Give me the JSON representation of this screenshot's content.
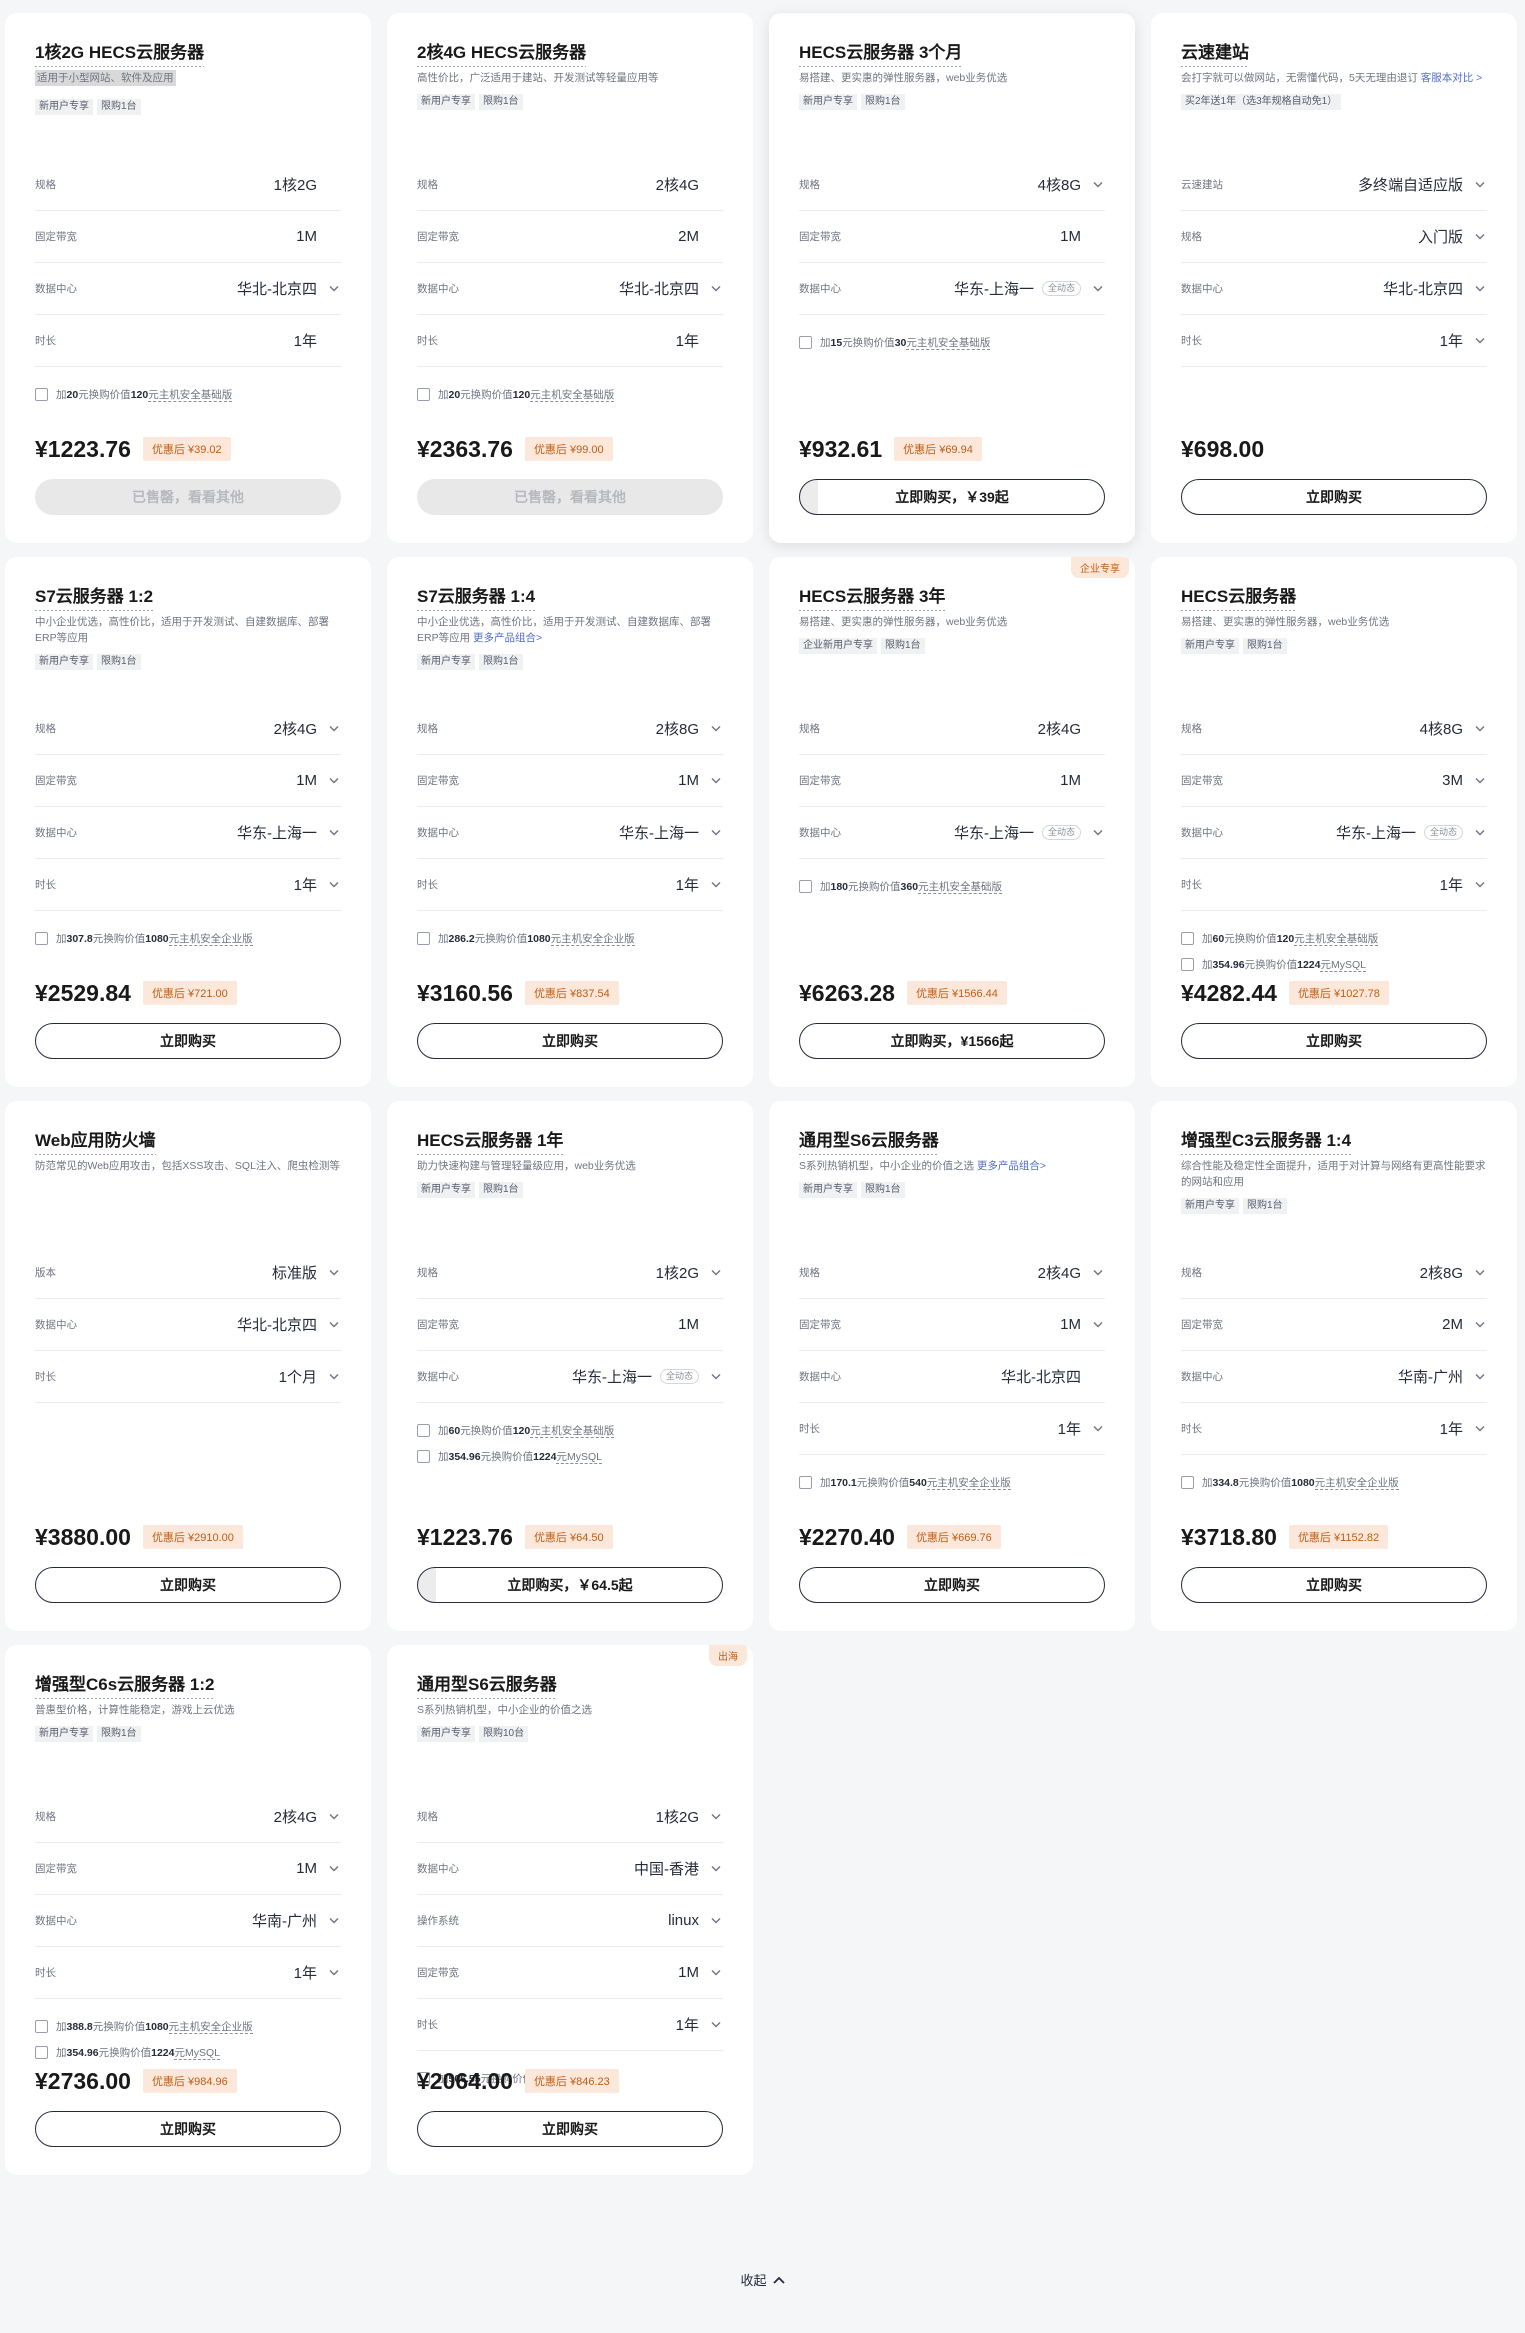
{
  "colors": {
    "accent": "#c15d14",
    "accent_bg": "#fbe8da",
    "text": "#252b3a",
    "link": "#526ecc"
  },
  "cards": [
    {
      "title": "1核2G HECS云服务器",
      "desc": "适用于小型网站、软件及应用",
      "desc_highlight": true,
      "tags": [
        "新用户专享",
        "限购1台"
      ],
      "rows": [
        {
          "label": "规格",
          "value": "1核2G",
          "chev": false
        },
        {
          "label": "固定带宽",
          "value": "1M",
          "chev": false
        },
        {
          "label": "数据中心",
          "value": "华北-北京四",
          "chev": true
        },
        {
          "label": "时长",
          "value": "1年",
          "chev": false
        }
      ],
      "addons": [
        [
          "加",
          "20",
          "元换购价值",
          "120",
          "元主机安全基础版"
        ]
      ],
      "price": "¥1223.76",
      "discount": "优惠后 ¥39.02",
      "button": "已售罄，看看其他",
      "button_state": "disabled"
    },
    {
      "title": "2核4G HECS云服务器",
      "desc": "高性价比，广泛适用于建站、开发测试等轻量应用等",
      "tags": [
        "新用户专享",
        "限购1台"
      ],
      "rows": [
        {
          "label": "规格",
          "value": "2核4G",
          "chev": false
        },
        {
          "label": "固定带宽",
          "value": "2M",
          "chev": false
        },
        {
          "label": "数据中心",
          "value": "华北-北京四",
          "chev": true
        },
        {
          "label": "时长",
          "value": "1年",
          "chev": false
        }
      ],
      "addons": [
        [
          "加",
          "20",
          "元换购价值",
          "120",
          "元主机安全基础版"
        ]
      ],
      "price": "¥2363.76",
      "discount": "优惠后 ¥99.00",
      "button": "已售罄，看看其他",
      "button_state": "disabled"
    },
    {
      "title": "HECS云服务器 3个月",
      "desc": "易搭建、更实惠的弹性服务器，web业务优选",
      "tags": [
        "新用户专享",
        "限购1台"
      ],
      "active": true,
      "rows": [
        {
          "label": "规格",
          "value": "4核8G",
          "chev": true
        },
        {
          "label": "固定带宽",
          "value": "1M",
          "chev": false
        },
        {
          "label": "数据中心",
          "value": "华东-上海一",
          "chev": true,
          "badge": "全动态"
        }
      ],
      "addons": [
        [
          "加",
          "15",
          "元换购价值",
          "30",
          "元主机安全基础版"
        ]
      ],
      "price": "¥932.61",
      "discount": "优惠后 ¥69.94",
      "button": "立即购买，￥39起",
      "button_state": "progress"
    },
    {
      "title": "云速建站",
      "desc": "会打字就可以做网站，无需懂代码，5天无理由退订 ",
      "desc_link": "客服本对比 >",
      "tags": [
        "买2年送1年（选3年规格自动免1）"
      ],
      "rows": [
        {
          "label": "云速建站",
          "value": "多终端自适应版",
          "chev": true
        },
        {
          "label": "规格",
          "value": "入门版",
          "chev": true
        },
        {
          "label": "数据中心",
          "value": "华北-北京四",
          "chev": true
        },
        {
          "label": "时长",
          "value": "1年",
          "chev": true
        }
      ],
      "addons": [],
      "price": "¥698.00",
      "discount": "",
      "button": "立即购买",
      "button_state": "normal"
    },
    {
      "title": "S7云服务器 1:2",
      "desc": "中小企业优选，高性价比，适用于开发测试、自建数据库、部署ERP等应用",
      "tags": [
        "新用户专享",
        "限购1台"
      ],
      "rows": [
        {
          "label": "规格",
          "value": "2核4G",
          "chev": true
        },
        {
          "label": "固定带宽",
          "value": "1M",
          "chev": true
        },
        {
          "label": "数据中心",
          "value": "华东-上海一",
          "chev": true
        },
        {
          "label": "时长",
          "value": "1年",
          "chev": true
        }
      ],
      "addons": [
        [
          "加",
          "307.8",
          "元换购价值",
          "1080",
          "元主机安全企业版"
        ]
      ],
      "price": "¥2529.84",
      "discount": "优惠后 ¥721.00",
      "button": "立即购买",
      "button_state": "normal"
    },
    {
      "title": "S7云服务器 1:4",
      "desc": "中小企业优选，高性价比，适用于开发测试、自建数据库、部署ERP等应用 ",
      "desc_link": "更多产品组合>",
      "tags": [
        "新用户专享",
        "限购1台"
      ],
      "rows": [
        {
          "label": "规格",
          "value": "2核8G",
          "chev": true
        },
        {
          "label": "固定带宽",
          "value": "1M",
          "chev": true
        },
        {
          "label": "数据中心",
          "value": "华东-上海一",
          "chev": true
        },
        {
          "label": "时长",
          "value": "1年",
          "chev": true
        }
      ],
      "addons": [
        [
          "加",
          "286.2",
          "元换购价值",
          "1080",
          "元主机安全企业版"
        ]
      ],
      "price": "¥3160.56",
      "discount": "优惠后 ¥837.54",
      "button": "立即购买",
      "button_state": "normal"
    },
    {
      "title": "HECS云服务器 3年",
      "desc": "易搭建、更实惠的弹性服务器，web业务优选",
      "corner": "企业专享",
      "tags": [
        "企业新用户专享",
        "限购1台"
      ],
      "rows": [
        {
          "label": "规格",
          "value": "2核4G",
          "chev": false
        },
        {
          "label": "固定带宽",
          "value": "1M",
          "chev": false
        },
        {
          "label": "数据中心",
          "value": "华东-上海一",
          "chev": true,
          "badge": "全动态"
        }
      ],
      "addons": [
        [
          "加",
          "180",
          "元换购价值",
          "360",
          "元主机安全基础版"
        ]
      ],
      "price": "¥6263.28",
      "discount": "优惠后 ¥1566.44",
      "button": "立即购买，¥1566起",
      "button_state": "normal"
    },
    {
      "title": "HECS云服务器",
      "desc": "易搭建、更实惠的弹性服务器，web业务优选",
      "tags": [
        "新用户专享",
        "限购1台"
      ],
      "rows": [
        {
          "label": "规格",
          "value": "4核8G",
          "chev": true
        },
        {
          "label": "固定带宽",
          "value": "3M",
          "chev": true
        },
        {
          "label": "数据中心",
          "value": "华东-上海一",
          "chev": true,
          "badge": "全动态"
        },
        {
          "label": "时长",
          "value": "1年",
          "chev": true
        }
      ],
      "addons": [
        [
          "加",
          "60",
          "元换购价值",
          "120",
          "元主机安全基础版"
        ],
        [
          "加",
          "354.96",
          "元换购价值",
          "1224",
          "元MySQL"
        ]
      ],
      "price": "¥4282.44",
      "discount": "优惠后 ¥1027.78",
      "button": "立即购买",
      "button_state": "normal"
    },
    {
      "title": "Web应用防火墙",
      "desc": "防范常见的Web应用攻击，包括XSS攻击、SQL注入、爬虫检测等",
      "tags": [],
      "rows": [
        {
          "label": "版本",
          "value": "标准版",
          "chev": true
        },
        {
          "label": "数据中心",
          "value": "华北-北京四",
          "chev": true
        },
        {
          "label": "时长",
          "value": "1个月",
          "chev": true
        }
      ],
      "addons": [],
      "price": "¥3880.00",
      "discount": "优惠后 ¥2910.00",
      "button": "立即购买",
      "button_state": "normal"
    },
    {
      "title": "HECS云服务器 1年",
      "desc": "助力快速构建与管理轻量级应用，web业务优选",
      "tags": [
        "新用户专享",
        "限购1台"
      ],
      "rows": [
        {
          "label": "规格",
          "value": "1核2G",
          "chev": true
        },
        {
          "label": "固定带宽",
          "value": "1M",
          "chev": false
        },
        {
          "label": "数据中心",
          "value": "华东-上海一",
          "chev": true,
          "badge": "全动态"
        }
      ],
      "addons": [
        [
          "加",
          "60",
          "元换购价值",
          "120",
          "元主机安全基础版"
        ],
        [
          "加",
          "354.96",
          "元换购价值",
          "1224",
          "元MySQL"
        ]
      ],
      "price": "¥1223.76",
      "discount": "优惠后 ¥64.50",
      "button": "立即购买，￥64.5起",
      "button_state": "progress"
    },
    {
      "title": "通用型S6云服务器",
      "desc": "S系列热销机型，中小企业的价值之选 ",
      "desc_link": "更多产品组合>",
      "tags": [
        "新用户专享",
        "限购1台"
      ],
      "rows": [
        {
          "label": "规格",
          "value": "2核4G",
          "chev": true
        },
        {
          "label": "固定带宽",
          "value": "1M",
          "chev": true
        },
        {
          "label": "数据中心",
          "value": "华北-北京四",
          "chev": false
        },
        {
          "label": "时长",
          "value": "1年",
          "chev": true
        }
      ],
      "addons": [
        [
          "加",
          "170.1",
          "元换购价值",
          "540",
          "元主机安全企业版"
        ]
      ],
      "price": "¥2270.40",
      "discount": "优惠后 ¥669.76",
      "button": "立即购买",
      "button_state": "normal"
    },
    {
      "title": "增强型C3云服务器 1:4",
      "desc": "综合性能及稳定性全面提升，适用于对计算与网络有更高性能要求的网站和应用",
      "tags": [
        "新用户专享",
        "限购1台"
      ],
      "rows": [
        {
          "label": "规格",
          "value": "2核8G",
          "chev": true
        },
        {
          "label": "固定带宽",
          "value": "2M",
          "chev": true
        },
        {
          "label": "数据中心",
          "value": "华南-广州",
          "chev": true
        },
        {
          "label": "时长",
          "value": "1年",
          "chev": true
        }
      ],
      "addons": [
        [
          "加",
          "334.8",
          "元换购价值",
          "1080",
          "元主机安全企业版"
        ]
      ],
      "price": "¥3718.80",
      "discount": "优惠后 ¥1152.82",
      "button": "立即购买",
      "button_state": "normal"
    },
    {
      "title": "增强型C6s云服务器 1:2",
      "desc": "普惠型价格，计算性能稳定，游戏上云优选",
      "tags": [
        "新用户专享",
        "限购1台"
      ],
      "rows": [
        {
          "label": "规格",
          "value": "2核4G",
          "chev": true
        },
        {
          "label": "固定带宽",
          "value": "1M",
          "chev": true
        },
        {
          "label": "数据中心",
          "value": "华南-广州",
          "chev": true
        },
        {
          "label": "时长",
          "value": "1年",
          "chev": true
        }
      ],
      "addons": [
        [
          "加",
          "388.8",
          "元换购价值",
          "1080",
          "元主机安全企业版"
        ],
        [
          "加",
          "354.96",
          "元换购价值",
          "1224",
          "元MySQL"
        ]
      ],
      "price": "¥2736.00",
      "discount": "优惠后 ¥984.96",
      "button": "立即购买",
      "button_state": "normal"
    },
    {
      "title": "通用型S6云服务器",
      "desc": "S系列热销机型，中小企业的价值之选",
      "corner": "出海",
      "tags": [
        "新用户专享",
        "限购10台"
      ],
      "rows": [
        {
          "label": "规格",
          "value": "1核2G",
          "chev": true
        },
        {
          "label": "数据中心",
          "value": "中国-香港",
          "chev": true
        },
        {
          "label": "操作系统",
          "value": "linux",
          "chev": true
        },
        {
          "label": "固定带宽",
          "value": "1M",
          "chev": true
        },
        {
          "label": "时长",
          "value": "1年",
          "chev": true
        }
      ],
      "addons": [
        [
          "加",
          "506.55",
          "元换购价值",
          "1013.1",
          "元MySQL"
        ]
      ],
      "price": "¥2064.00",
      "discount": "优惠后 ¥846.23",
      "button": "立即购买",
      "button_state": "normal"
    }
  ],
  "footer": {
    "collapse_label": "收起"
  }
}
